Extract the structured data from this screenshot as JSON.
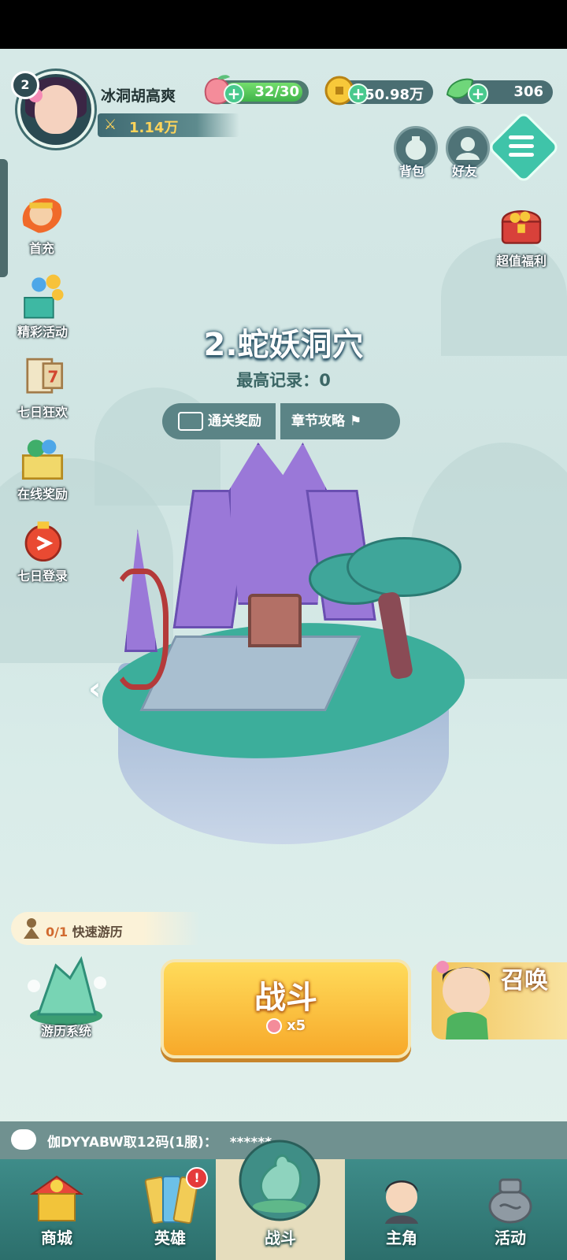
{
  "player": {
    "level": "2",
    "name": "冰洞胡高爽",
    "power": "1.14万"
  },
  "resources": {
    "stamina": "32/30",
    "coins": "50.98万",
    "gems": "306"
  },
  "top_buttons": {
    "bag": "背包",
    "friends": "好友"
  },
  "right_side": {
    "super_welfare": "超值福利"
  },
  "left_side": [
    {
      "label": "首充"
    },
    {
      "label": "精彩活动"
    },
    {
      "label": "七日狂欢"
    },
    {
      "label": "在线奖励"
    },
    {
      "label": "七日登录"
    }
  ],
  "stage": {
    "title": "2.蛇妖洞穴",
    "record_label": "最高记录：",
    "record_value": "0",
    "clear_reward": "通关奖励",
    "chapter_guide": "章节攻略"
  },
  "quick_tour": {
    "count": "0/1",
    "label": "快速游历"
  },
  "tour_system": "游历系统",
  "battle": {
    "label": "战斗",
    "cost": "x5"
  },
  "summon": "召唤",
  "chat": {
    "message": "伽DYYABW取12码(1服)：",
    "masked": "******"
  },
  "nav": [
    {
      "label": "商城"
    },
    {
      "label": "英雄",
      "badge": "!"
    },
    {
      "label": "战斗"
    },
    {
      "label": "主角"
    },
    {
      "label": "活动"
    }
  ],
  "colors": {
    "accent": "#3fc4a9",
    "battle_button": "#f7a92a",
    "nav_bg": "#2c6f6c"
  }
}
